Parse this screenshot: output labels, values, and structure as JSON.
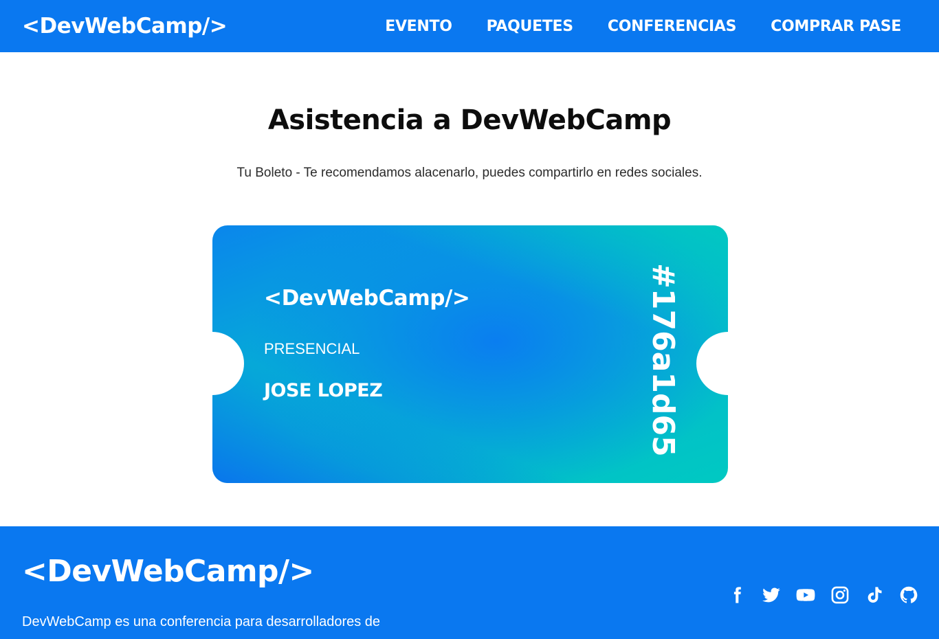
{
  "header": {
    "logo": "<DevWebCamp/>",
    "nav": [
      "EVENTO",
      "PAQUETES",
      "CONFERENCIAS",
      "COMPRAR PASE"
    ]
  },
  "main": {
    "title": "Asistencia a DevWebCamp",
    "subtitle": "Tu Boleto - Te recomendamos alacenarlo, puedes compartirlo en redes sociales."
  },
  "ticket": {
    "logo": "<DevWebCamp/>",
    "plan": "PRESENCIAL",
    "name": "JOSE LOPEZ",
    "code": "#176a1d65"
  },
  "footer": {
    "logo": "<DevWebCamp/>",
    "description": "DevWebCamp es una conferencia para desarrolladores de",
    "social_icons": [
      "facebook-icon",
      "twitter-icon",
      "youtube-icon",
      "instagram-icon",
      "tiktok-icon",
      "github-icon"
    ]
  },
  "colors": {
    "brand_blue": "#0a78f0",
    "ticket_teal": "#00c9c2"
  }
}
